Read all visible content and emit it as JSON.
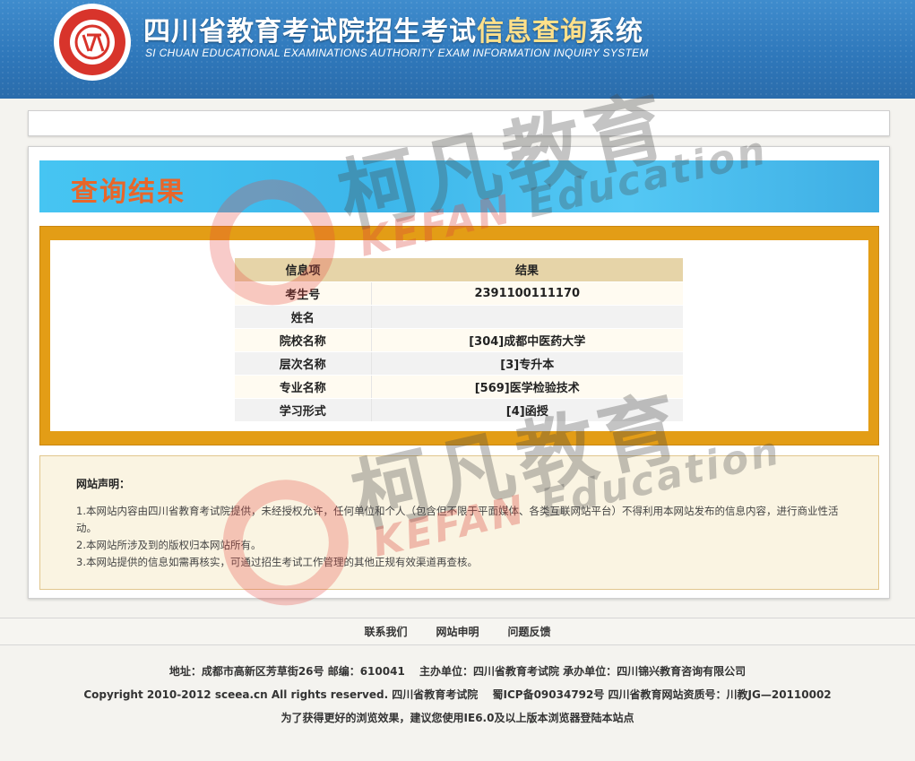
{
  "header": {
    "title_part1": "四川省教育考试院招生考试",
    "title_highlight": "信息查询",
    "title_part2": "系统",
    "subtitle": "SI CHUAN EDUCATIONAL EXAMINATIONS AUTHORITY EXAM INFORMATION INQUIRY SYSTEM"
  },
  "result": {
    "banner_title": "查询结果",
    "columns": [
      "信息项",
      "结果"
    ],
    "rows": [
      {
        "key": "考生号",
        "value": "2391100111170"
      },
      {
        "key": "姓名",
        "value": ""
      },
      {
        "key": "院校名称",
        "value": "[304]成都中医药大学"
      },
      {
        "key": "层次名称",
        "value": "[3]专升本"
      },
      {
        "key": "专业名称",
        "value": "[569]医学检验技术"
      },
      {
        "key": "学习形式",
        "value": "[4]函授"
      }
    ]
  },
  "declaration": {
    "title": "网站声明：",
    "lines": [
      "1.本网站内容由四川省教育考试院提供，未经授权允许，任何单位和个人（包含但不限于平面媒体、各类互联网站平台）不得利用本网站发布的信息内容，进行商业性活动。",
      "2.本网站所涉及到的版权归本网站所有。",
      "3.本网站提供的信息如需再核实，可通过招生考试工作管理的其他正规有效渠道再查核。"
    ]
  },
  "footer": {
    "links": [
      "联系我们",
      "网站申明",
      "问题反馈"
    ],
    "address": "地址：成都市高新区芳草街26号 邮编：610041",
    "sponsor": "主办单位：四川省教育考试院 承办单位：四川锦兴教育咨询有限公司",
    "copyright": "Copyright 2010-2012 sceea.cn All rights reserved. 四川省教育考试院",
    "icp": "蜀ICP备09034792号 四川省教育网站资质号：川教JG—20110002",
    "browser_tip": "为了获得更好的浏览效果，建议您使用IE6.0及以上版本浏览器登陆本站点"
  },
  "watermark": {
    "cn": "柯凡教育",
    "en_part1": "KEFAN",
    "en_part2": "Education"
  }
}
